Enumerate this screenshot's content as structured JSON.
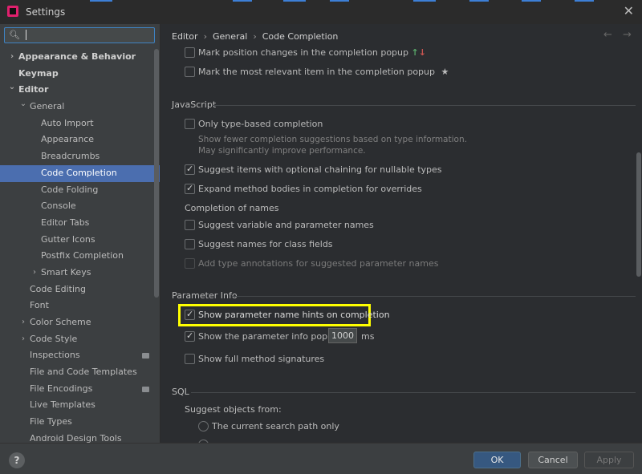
{
  "window": {
    "title": "Settings"
  },
  "search": {
    "value": ""
  },
  "sidebar": {
    "items": [
      {
        "label": "Appearance & Behavior",
        "level": 0,
        "arrow": "right",
        "bold": true
      },
      {
        "label": "Keymap",
        "level": 0,
        "arrow": "",
        "bold": true
      },
      {
        "label": "Editor",
        "level": 0,
        "arrow": "down",
        "bold": true
      },
      {
        "label": "General",
        "level": 1,
        "arrow": "down"
      },
      {
        "label": "Auto Import",
        "level": 2,
        "arrow": ""
      },
      {
        "label": "Appearance",
        "level": 2,
        "arrow": ""
      },
      {
        "label": "Breadcrumbs",
        "level": 2,
        "arrow": ""
      },
      {
        "label": "Code Completion",
        "level": 2,
        "arrow": "",
        "selected": true
      },
      {
        "label": "Code Folding",
        "level": 2,
        "arrow": ""
      },
      {
        "label": "Console",
        "level": 2,
        "arrow": ""
      },
      {
        "label": "Editor Tabs",
        "level": 2,
        "arrow": ""
      },
      {
        "label": "Gutter Icons",
        "level": 2,
        "arrow": ""
      },
      {
        "label": "Postfix Completion",
        "level": 2,
        "arrow": ""
      },
      {
        "label": "Smart Keys",
        "level": 2,
        "arrow": "right"
      },
      {
        "label": "Code Editing",
        "level": 1,
        "arrow": ""
      },
      {
        "label": "Font",
        "level": 1,
        "arrow": ""
      },
      {
        "label": "Color Scheme",
        "level": 1,
        "arrow": "right"
      },
      {
        "label": "Code Style",
        "level": 1,
        "arrow": "right"
      },
      {
        "label": "Inspections",
        "level": 1,
        "arrow": "",
        "badge": true
      },
      {
        "label": "File and Code Templates",
        "level": 1,
        "arrow": ""
      },
      {
        "label": "File Encodings",
        "level": 1,
        "arrow": "",
        "badge": true
      },
      {
        "label": "Live Templates",
        "level": 1,
        "arrow": ""
      },
      {
        "label": "File Types",
        "level": 1,
        "arrow": ""
      },
      {
        "label": "Android Design Tools",
        "level": 1,
        "arrow": ""
      }
    ]
  },
  "breadcrumb": {
    "items": [
      "Editor",
      "General",
      "Code Completion"
    ]
  },
  "options": {
    "mark_position": "Mark position changes in the completion popup",
    "mark_relevant": "Mark the most relevant item in the completion popup",
    "star": "★"
  },
  "javascript": {
    "title": "JavaScript",
    "only_type_based": "Only type-based completion",
    "only_type_based_desc": "Show fewer completion suggestions based on type information. May significantly improve performance.",
    "optional_chaining": "Suggest items with optional chaining for nullable types",
    "expand_method": "Expand method bodies in completion for overrides",
    "completion_of_names": "Completion of names",
    "suggest_variable": "Suggest variable and parameter names",
    "suggest_class_fields": "Suggest names for class fields",
    "add_type_annotations": "Add type annotations for suggested parameter names"
  },
  "parameter_info": {
    "title": "Parameter Info",
    "show_hints": "Show parameter name hints on completion",
    "show_popup_prefix": "Show the parameter info popup in",
    "popup_delay": "1000",
    "popup_unit": "ms",
    "show_full_signatures": "Show full method signatures"
  },
  "sql": {
    "title": "SQL",
    "suggest_from": "Suggest objects from:",
    "current_search_path": "The current search path only"
  },
  "footer": {
    "help": "?",
    "ok": "OK",
    "cancel": "Cancel",
    "apply": "Apply"
  },
  "colors": {
    "selected": "#4b6eaf",
    "highlight": "#ffff00",
    "ok_button": "#365880"
  }
}
